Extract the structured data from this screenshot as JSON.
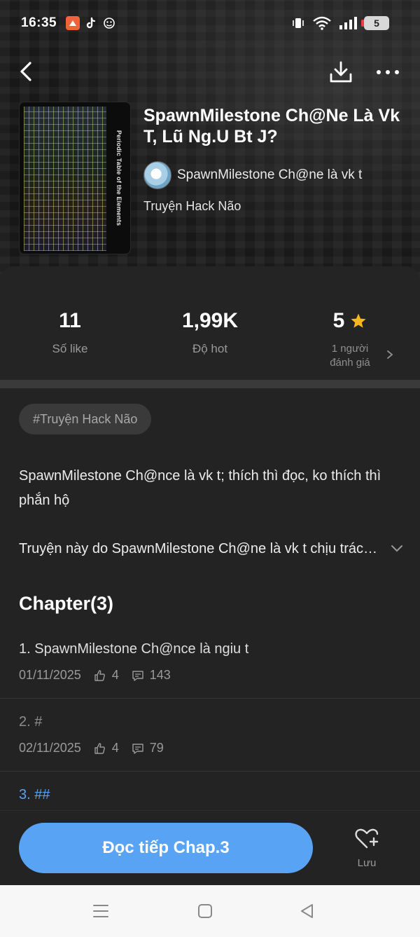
{
  "status_bar": {
    "time": "16:35",
    "battery": "5",
    "apps": [
      "app-shortcut-icon",
      "tiktok-icon",
      "meme-face-icon"
    ]
  },
  "story": {
    "title": "SpawnMilestone Ch@Ne Là Vk T, Lũ Ng.U Bt J?",
    "author": "SpawnMilestone Ch@ne là vk t",
    "genre": "Truyện Hack Não",
    "cover_text": "Periodic Table of the Elements"
  },
  "stats": {
    "likes": {
      "value": "11",
      "label": "Số like"
    },
    "hot": {
      "value": "1,99K",
      "label": "Độ hot"
    },
    "rating": {
      "value": "5",
      "label_line1": "1 người",
      "label_line2": "đánh giá"
    }
  },
  "tag": "#Truyện Hack Não",
  "description": "SpawnMilestone Ch@nce là vk t; thích thì đọc, ko thích thì phắn hộ",
  "description_note": "Truyện này do SpawnMilestone Ch@ne là vk t chịu trách nhiệm",
  "chapters_heading": "Chapter(3)",
  "chapters": [
    {
      "title": "1. SpawnMilestone Ch@nce là ngiu t",
      "date": "01/11/2025",
      "likes": "4",
      "comments": "143"
    },
    {
      "title": "2. #",
      "date": "02/11/2025",
      "likes": "4",
      "comments": "79"
    },
    {
      "title": "3. ##"
    }
  ],
  "bottom": {
    "read_button": "Đọc tiếp Chap.3",
    "save_label": "Lưu"
  },
  "colors": {
    "accent": "#59a3f4",
    "sheet_bg": "#232323",
    "star": "#f5b61e"
  }
}
